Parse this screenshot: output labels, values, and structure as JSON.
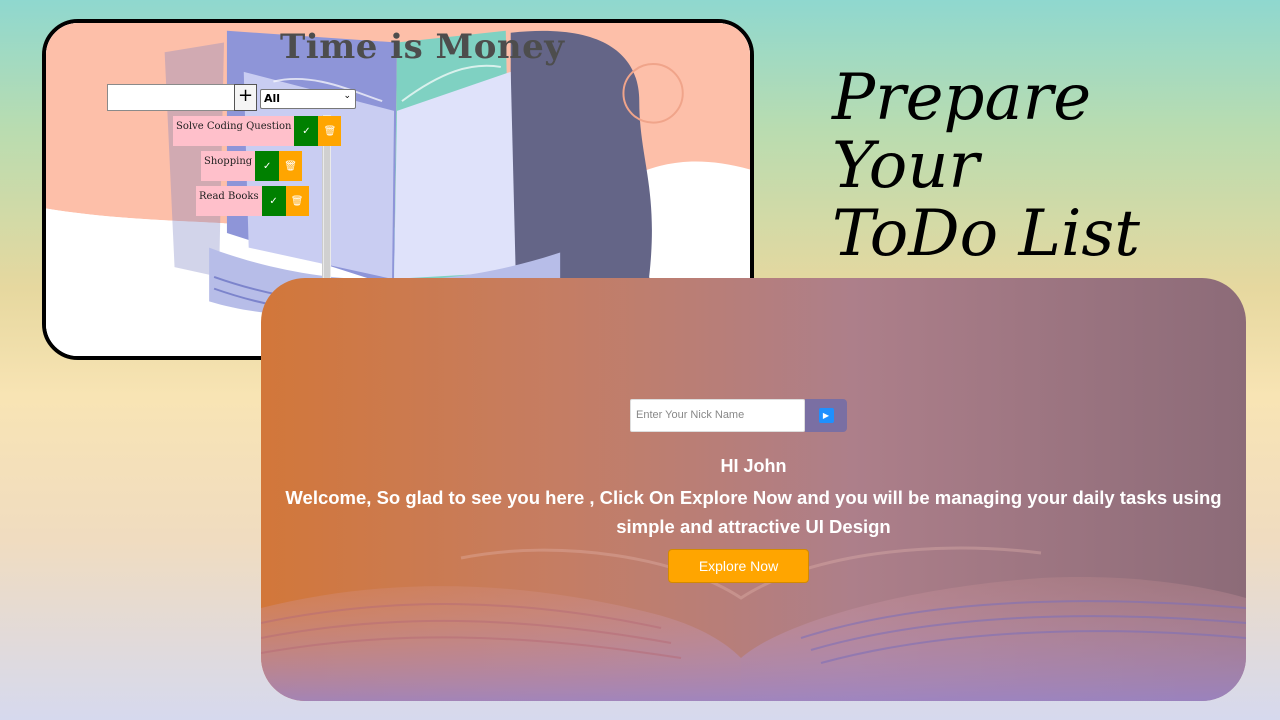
{
  "todo_app": {
    "title": "Time is Money",
    "new_task_value": "",
    "add_label": "+",
    "filter_selected": "All",
    "tasks": [
      {
        "label": "Solve Coding Question",
        "done_icon": "✓",
        "delete_icon": "🗑"
      },
      {
        "label": "Shopping",
        "done_icon": "✓",
        "delete_icon": "🗑"
      },
      {
        "label": "Read Books",
        "done_icon": "✓",
        "delete_icon": "🗑"
      }
    ],
    "colors": {
      "task_bg": "#ffc0cb",
      "check_bg": "#008000",
      "trash_bg": "#ffa500"
    }
  },
  "headline": {
    "line1": "Prepare Your",
    "line2": "ToDo List"
  },
  "landing": {
    "nick_placeholder": "Enter Your Nick Name",
    "go_icon": "play-icon",
    "greeting": "HI John",
    "welcome_text": "Welcome, So glad to see you here , Click On Explore Now and you will be managing your daily tasks using simple and attractive UI Design",
    "explore_label": "Explore Now",
    "colors": {
      "explore_bg": "#ffa500",
      "go_bg": "#1e90ff"
    }
  }
}
